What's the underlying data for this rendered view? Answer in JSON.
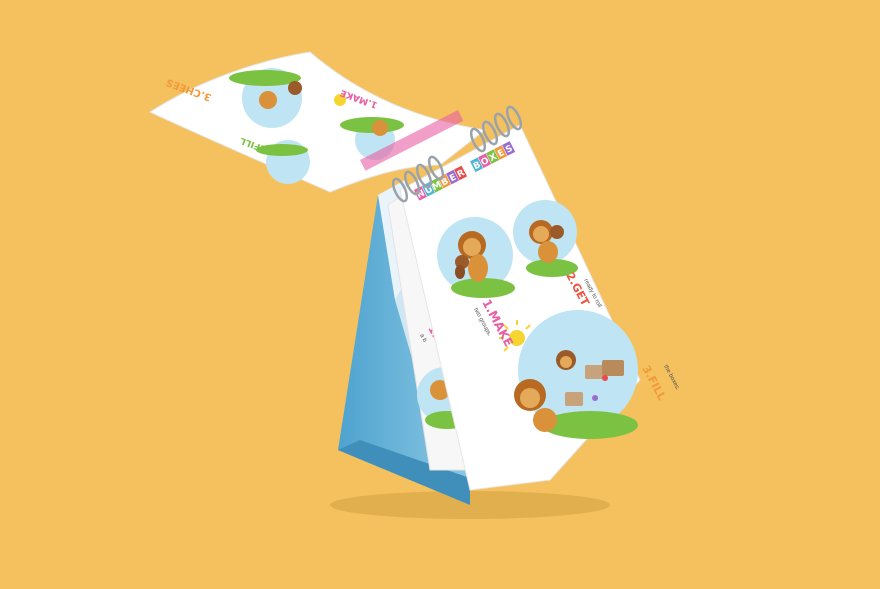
{
  "background_color": "#f4c15e",
  "calendar": {
    "title_letters": [
      "N",
      "U",
      "M",
      "B",
      "E",
      "R",
      " ",
      "B",
      "O",
      "X",
      "E",
      "S"
    ],
    "title_colors": [
      "#e85fa3",
      "#4fb5d8",
      "#7cc242",
      "#f29a3a",
      "#9b6bd1",
      "#e94b4b",
      "#ffffff",
      "#4fb5d8",
      "#e85fa3",
      "#7cc242",
      "#f29a3a",
      "#9b6bd1"
    ],
    "steps": [
      {
        "label": "1.MAKE",
        "sub": "two groups.",
        "color": "#e85fa3"
      },
      {
        "label": "2.GET",
        "sub": "ready to roll",
        "color": "#f0533d"
      },
      {
        "label": "3.FILL",
        "sub": "the boxes.",
        "color": "#f29a3a"
      }
    ],
    "back_page": {
      "label": "1.CHOO",
      "sub": "a b"
    },
    "flipped_page": {
      "labels": [
        "3.CHEES",
        "2.FILL",
        "1.MAKE"
      ]
    },
    "stand_color": "#6cb6d8",
    "colors": {
      "sky": "#bfe4f3",
      "grass": "#7cc242",
      "lion": "#d9913a",
      "monkey": "#9b5a2a",
      "sun": "#f7d531"
    }
  }
}
